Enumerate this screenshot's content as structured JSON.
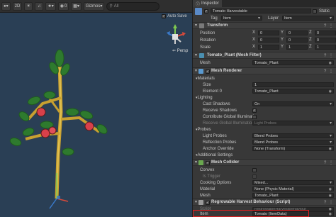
{
  "scene": {
    "toolbar": {
      "shading_icon": "sphere-icon",
      "mode_2d": "2D",
      "light_icon": "light-icon",
      "audio_icon": "audio-icon",
      "fx_icon": "effects-icon",
      "visibility_icon": "eye-icon",
      "hidden_count": "0",
      "grid_icon": "grid-icon",
      "gizmos_label": "Gizmos",
      "search_prefix": "All"
    },
    "auto_save_label": "Auto Save",
    "auto_save_checked": true,
    "persp_label": "Persp"
  },
  "inspector": {
    "tab_label": "Inspector",
    "object": {
      "name": "Tomato Harvestable",
      "static_label": "Static",
      "tag_label": "Tag",
      "tag_value": "Item",
      "layer_label": "Layer",
      "layer_value": "Item"
    },
    "transform": {
      "title": "Transform",
      "position_label": "Position",
      "rotation_label": "Rotation",
      "scale_label": "Scale",
      "position": [
        "0",
        "0",
        "0"
      ],
      "rotation": [
        "0",
        "0",
        "0"
      ],
      "scale": [
        "1",
        "1",
        "1"
      ],
      "axis": [
        "X",
        "Y",
        "Z"
      ]
    },
    "mesh_filter": {
      "title": "Tomato_Plant (Mesh Filter)",
      "mesh_label": "Mesh",
      "mesh_value": "Tomato_Plant"
    },
    "mesh_renderer": {
      "title": "Mesh Renderer",
      "materials_label": "Materials",
      "size_label": "Size",
      "size_value": "1",
      "element_label": "Element 0",
      "element_value": "Tomato_Plant",
      "lighting_label": "Lighting",
      "cast_shadows_label": "Cast Shadows",
      "cast_shadows_value": "On",
      "receive_shadows_label": "Receive Shadows",
      "contribute_gi_label": "Contribute Global Illuminatio",
      "receive_gi_label": "Receive Global Illumination",
      "receive_gi_value": "Light Probes",
      "probes_label": "Probes",
      "light_probes_label": "Light Probes",
      "light_probes_value": "Blend Probes",
      "reflection_probes_label": "Reflection Probes",
      "reflection_probes_value": "Blend Probes",
      "anchor_override_label": "Anchor Override",
      "anchor_override_value": "None (Transform)",
      "additional_settings_label": "Additional Settings"
    },
    "mesh_collider": {
      "title": "Mesh Collider",
      "convex_label": "Convex",
      "is_trigger_label": "Is Trigger",
      "cooking_options_label": "Cooking Options",
      "cooking_options_value": "Mixed...",
      "material_label": "Material",
      "material_value": "None (Physic Material)",
      "mesh_label": "Mesh",
      "mesh_value": "Tomato_Plant"
    },
    "script_component": {
      "title": "Regrowable Harvest Behaviour (Script)",
      "script_label": "Script",
      "script_value": "RegrowableHarvestBehaviour",
      "item_label": "Item",
      "item_value": "Tomato (ItemData)"
    }
  },
  "colors": {
    "highlight": "#e02020",
    "scene_bg": "#2a3f55",
    "accent_blue": "#3a79c8"
  }
}
